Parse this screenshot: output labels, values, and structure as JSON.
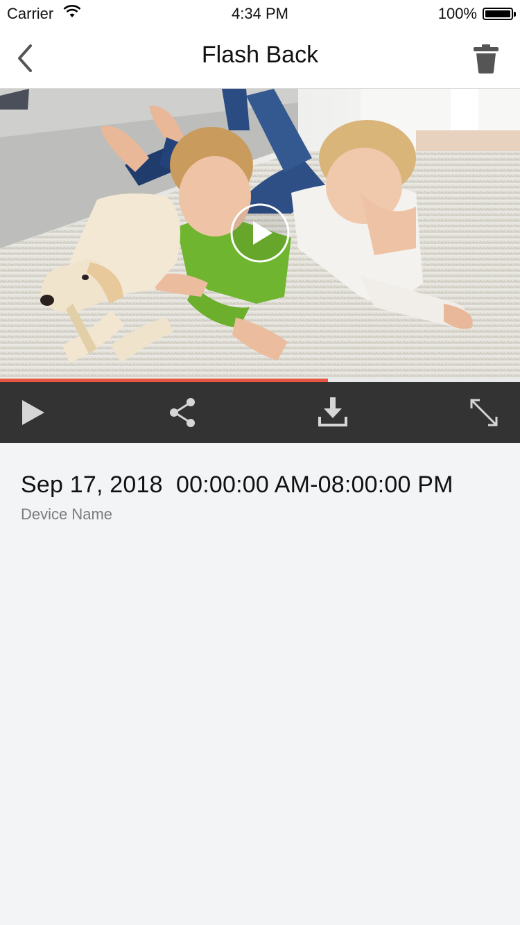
{
  "status_bar": {
    "carrier": "Carrier",
    "time": "4:34 PM",
    "battery": "100%",
    "wifi_icon": "wifi-icon",
    "battery_icon": "battery-icon"
  },
  "nav": {
    "title": "Flash Back",
    "back_icon": "chevron-left-icon",
    "delete_icon": "trash-icon"
  },
  "player": {
    "thumbnail": "family-with-dog-on-rug",
    "progress": 0.63,
    "progress_color": "#e65643",
    "controls": [
      "play-icon",
      "share-icon",
      "download-icon",
      "fullscreen-icon"
    ]
  },
  "recording": {
    "datetime": "Sep 17, 2018  00:00:00 AM-08:00:00 PM",
    "device": "Device Name"
  }
}
